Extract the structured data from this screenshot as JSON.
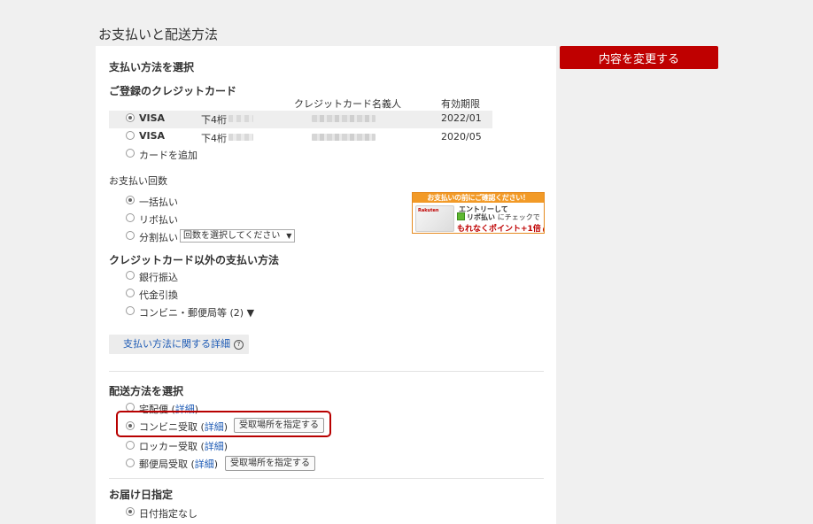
{
  "page_title": "お支払いと配送方法",
  "change_button_label": "内容を変更する",
  "payment": {
    "section_title": "支払い方法を選択",
    "registered_cards_title": "ご登録のクレジットカード",
    "columns": {
      "cardholder": "クレジットカード名義人",
      "expiry": "有効期限"
    },
    "cards": [
      {
        "brand": "VISA",
        "last4_label": "下4桁",
        "expiry": "2022/01",
        "selected": true
      },
      {
        "brand": "VISA",
        "last4_label": "下4桁",
        "expiry": "2020/05",
        "selected": false
      }
    ],
    "add_card_label": "カードを追加",
    "installment_title": "お支払い回数",
    "installments": [
      {
        "label": "一括払い",
        "selected": true
      },
      {
        "label": "リボ払い",
        "selected": false
      },
      {
        "label": "分割払い",
        "selected": false
      }
    ],
    "installment_select_value": "回数を選択してください",
    "other_methods_title": "クレジットカード以外の支払い方法",
    "other_methods": [
      {
        "label": "銀行振込"
      },
      {
        "label": "代金引換"
      },
      {
        "label": "コンビニ・郵便局等 (2) ▼"
      }
    ],
    "details_link": "支払い方法に関する詳細",
    "help_glyph": "?"
  },
  "banner": {
    "header": "お支払いの前にご確認ください！",
    "card_brand": "Rakuten",
    "line1": "エントリーして",
    "line2_strong": "リボ払い",
    "line2_rest": "にチェックで",
    "line3": "もれなくポイント+1倍",
    "play_glyph": "▶"
  },
  "shipping": {
    "section_title": "配送方法を選択",
    "options": [
      {
        "label": "宅配便",
        "detail": "詳細",
        "selected": false
      },
      {
        "label": "コンビニ受取",
        "detail": "詳細",
        "button": "受取場所を指定する",
        "selected": true
      },
      {
        "label": "ロッカー受取",
        "detail": "詳細",
        "selected": false
      },
      {
        "label": "郵便局受取",
        "detail": "詳細",
        "button": "受取場所を指定する",
        "selected": false
      }
    ]
  },
  "delivery": {
    "section_title": "お届け日指定",
    "option_label": "日付指定なし"
  },
  "colors": {
    "accent_red": "#bf0000",
    "link_blue": "#1e5bb5",
    "banner_orange": "#f29a27"
  }
}
